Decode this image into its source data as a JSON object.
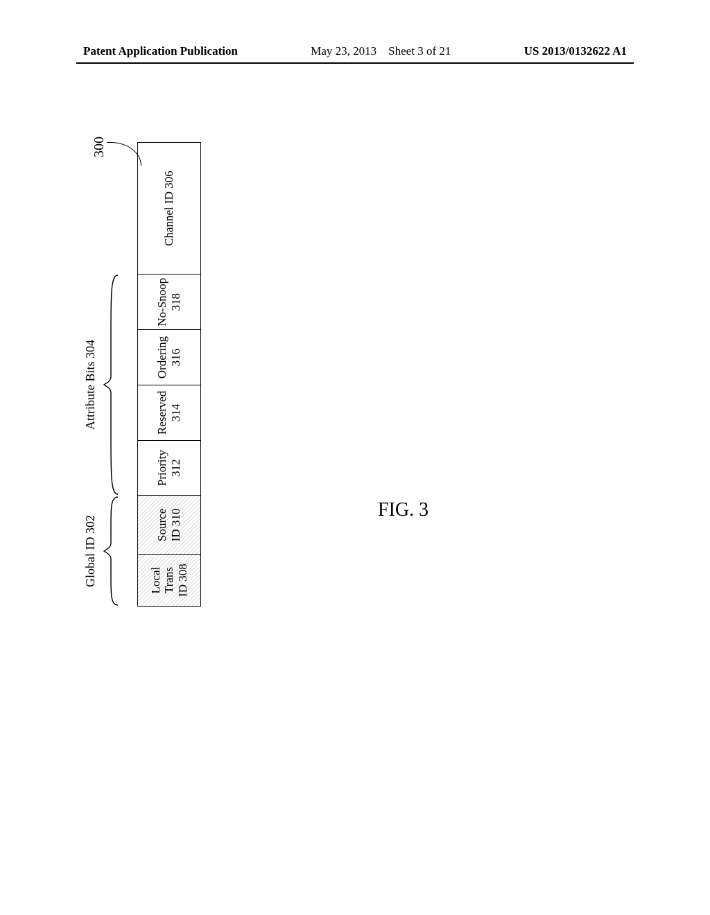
{
  "header": {
    "left": "Patent Application Publication",
    "date": "May 23, 2013",
    "sheet": "Sheet 3 of 21",
    "pubno": "US 2013/0132622 A1"
  },
  "figure": {
    "caption": "FIG. 3",
    "ref_label": "300",
    "groups": {
      "global_id": {
        "label": "Global ID 302"
      },
      "attribute_bits": {
        "label": "Attribute Bits 304"
      }
    },
    "fields": {
      "local_trans_id": {
        "l1": "Local",
        "l2": "Trans",
        "l3": "ID 308"
      },
      "source_id": {
        "l1": "Source",
        "l2": "ID 310"
      },
      "priority": {
        "l1": "Priority",
        "l2": "312"
      },
      "reserved": {
        "l1": "Reserved",
        "l2": "314"
      },
      "ordering": {
        "l1": "Ordering",
        "l2": "316"
      },
      "no_snoop": {
        "l1": "No-Snoop",
        "l2": "318"
      },
      "channel_id": {
        "l1": "Channel ID 306"
      }
    }
  }
}
